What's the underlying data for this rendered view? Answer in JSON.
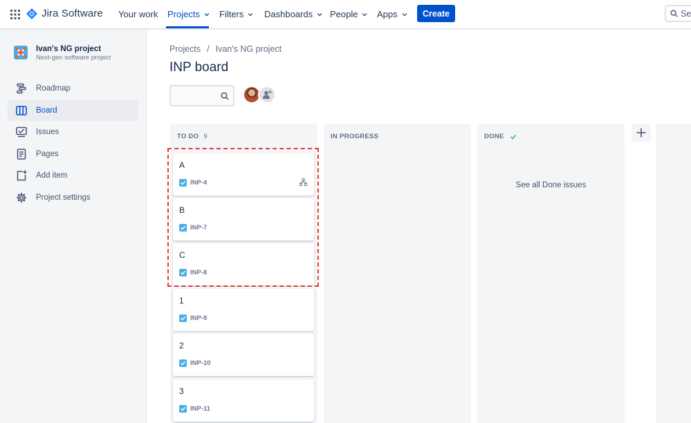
{
  "topnav": {
    "logo_text": "Jira Software",
    "items": [
      {
        "label": "Your work",
        "dropdown": false
      },
      {
        "label": "Projects",
        "dropdown": true
      },
      {
        "label": "Filters",
        "dropdown": true
      },
      {
        "label": "Dashboards",
        "dropdown": true
      },
      {
        "label": "People",
        "dropdown": true
      },
      {
        "label": "Apps",
        "dropdown": true
      }
    ],
    "active_item": "Projects",
    "create_label": "Create",
    "search_placeholder": "Se"
  },
  "sidebar": {
    "project_name": "Ivan's NG project",
    "project_type": "Next-gen software project",
    "items": [
      {
        "label": "Roadmap",
        "icon": "roadmap-icon"
      },
      {
        "label": "Board",
        "icon": "board-icon",
        "active": true
      },
      {
        "label": "Issues",
        "icon": "issues-icon"
      },
      {
        "label": "Pages",
        "icon": "pages-icon"
      },
      {
        "label": "Add item",
        "icon": "add-item-icon"
      },
      {
        "label": "Project settings",
        "icon": "gear-icon"
      }
    ]
  },
  "breadcrumb": [
    "Projects",
    "Ivan's NG project"
  ],
  "page_title": "INP board",
  "columns": [
    {
      "name": "TO DO",
      "count": "9"
    },
    {
      "name": "IN PROGRESS"
    },
    {
      "name": "DONE",
      "done_link": "See all Done issues"
    }
  ],
  "cards": [
    {
      "title": "A",
      "key": "INP-4",
      "has_child_icon": true
    },
    {
      "title": "B",
      "key": "INP-7"
    },
    {
      "title": "C",
      "key": "INP-8"
    },
    {
      "title": "1",
      "key": "INP-9"
    },
    {
      "title": "2",
      "key": "INP-10"
    },
    {
      "title": "3",
      "key": "INP-11"
    }
  ],
  "colors": {
    "brand_blue": "#0052CC",
    "highlight_red": "#E03C31",
    "done_check": "#36B37E",
    "issue_check": "#4BADE8"
  }
}
